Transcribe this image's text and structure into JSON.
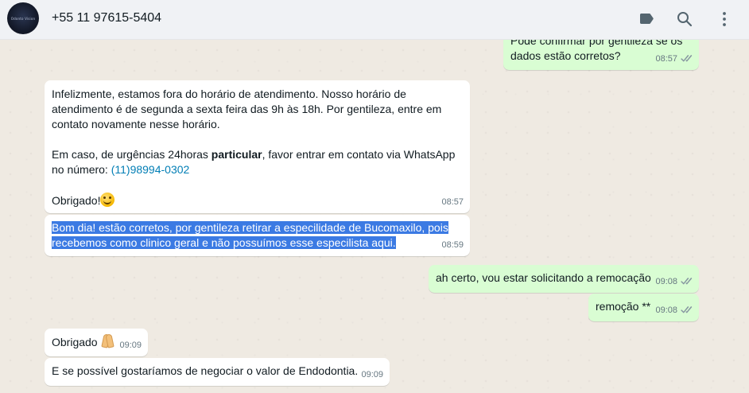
{
  "header": {
    "avatar_text": "Odonto Vision",
    "contact_name": "+55 11 97615-5404"
  },
  "icons": {
    "label": "label-icon",
    "search": "search-icon",
    "menu": "kebab-menu-icon"
  },
  "colors": {
    "incoming_bubble": "#ffffff",
    "outgoing_bubble": "#d9fdd3",
    "chat_background": "#efeae2",
    "header_background": "#f0f2f5",
    "link": "#027eb5",
    "selection": "#3b7ae3"
  },
  "messages": [
    {
      "direction": "out",
      "line1": "Pode confirmar por gentileza se os",
      "line2": "dados estão corretos?",
      "time": "08:57"
    },
    {
      "direction": "in",
      "line1": "Infelizmente, estamos fora do horário de atendimento. Nosso horário de",
      "line2": "atendimento é de segunda a sexta feira das 9h às 18h. Por gentileza, entre em",
      "line3": "contato novamente nesse horário.",
      "line4_pre": "Em caso, de urgências 24horas ",
      "line4_bold": "particular",
      "line4_post": ", favor entrar em contato via WhatsApp",
      "line5_pre": "no número: ",
      "phone_link": "(11)98994-0302",
      "line6": "Obrigado!",
      "time": "08:57"
    },
    {
      "direction": "in",
      "line1": "Bom dia! estão corretos, por gentileza retirar a especilidade de Bucomaxilo, pois",
      "line2": "recebemos como clinico geral e não possuímos esse especilista aqui.",
      "time": "08:59"
    },
    {
      "direction": "out",
      "text": "ah certo, vou estar solicitando a remocação",
      "time": "09:08"
    },
    {
      "direction": "out",
      "text": "remoção **",
      "time": "09:08"
    },
    {
      "direction": "in",
      "text": "Obrigado",
      "time": "09:09"
    },
    {
      "direction": "in",
      "text": "E se possível gostaríamos de negociar o valor de Endodontia.",
      "time": "09:09"
    }
  ]
}
